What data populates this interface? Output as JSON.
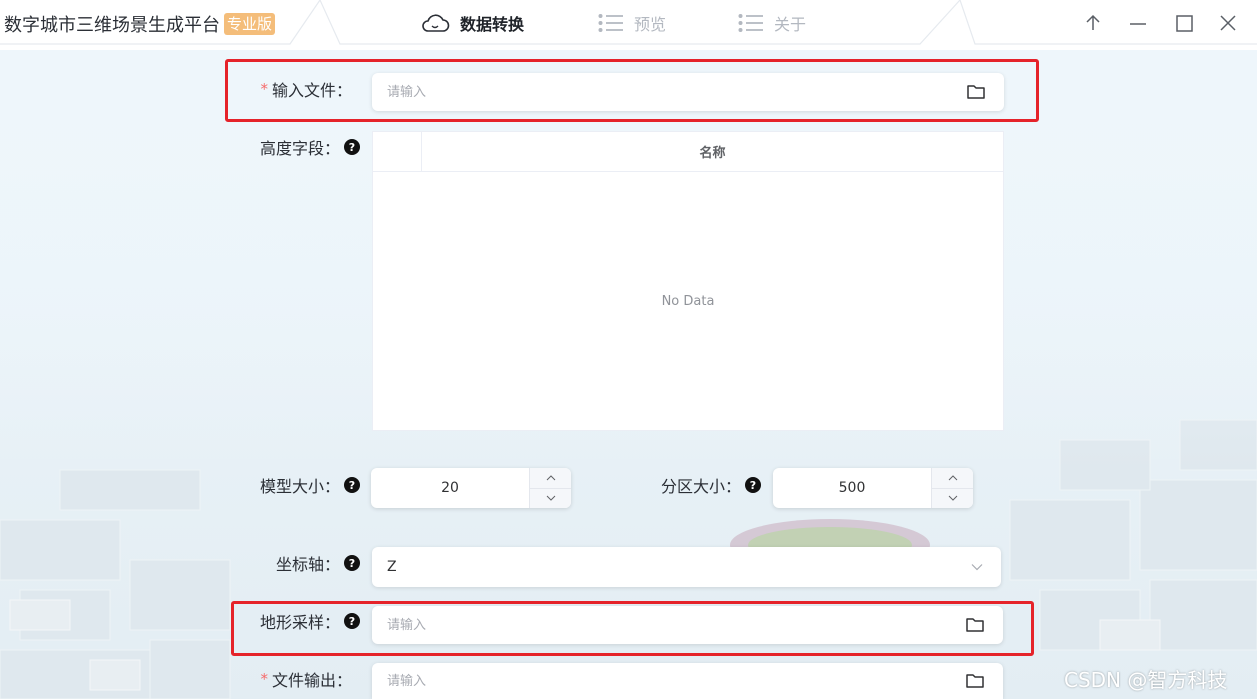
{
  "app": {
    "title": "数字城市三维场景生成平台",
    "edition": "专业版"
  },
  "nav": {
    "tabs": [
      {
        "label": "数据转换",
        "icon": "cloud-icon",
        "active": true
      },
      {
        "label": "预览",
        "icon": "list-icon",
        "active": false
      },
      {
        "label": "关于",
        "icon": "list-icon",
        "active": false
      }
    ]
  },
  "window_controls": [
    "arrow-up-icon",
    "minimize-icon",
    "maximize-icon",
    "close-icon"
  ],
  "form": {
    "input_file": {
      "label": "输入文件：",
      "required": true,
      "placeholder": "请输入",
      "value": ""
    },
    "height_field": {
      "label": "高度字段：",
      "table_header": "名称",
      "empty_text": "No Data"
    },
    "model_size": {
      "label": "模型大小：",
      "value": "20"
    },
    "partition_size": {
      "label": "分区大小：",
      "value": "500"
    },
    "axis": {
      "label": "坐标轴：",
      "value": "Z"
    },
    "terrain_sampling": {
      "label": "地形采样：",
      "placeholder": "请输入",
      "value": ""
    },
    "file_output": {
      "label": "文件输出：",
      "required": true,
      "placeholder": "请输入",
      "value": ""
    }
  },
  "watermark": "CSDN @智方科技",
  "colors": {
    "highlight": "#e5232a",
    "required": "#f56c6c",
    "badge": "#f4bd7a"
  }
}
